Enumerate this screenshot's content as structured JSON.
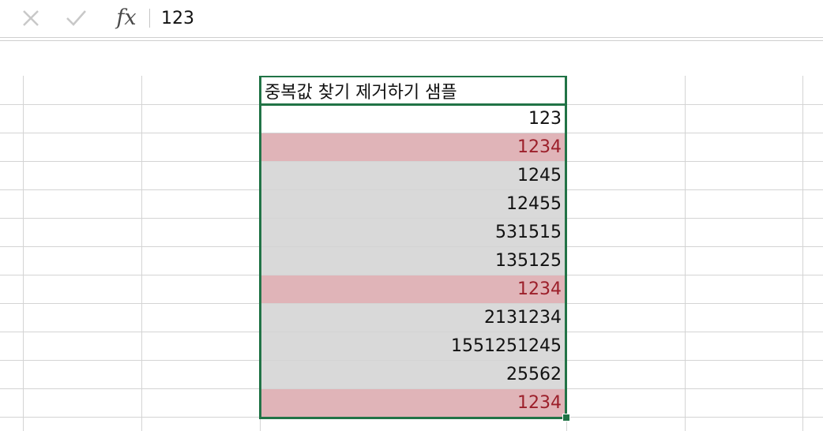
{
  "formula_bar": {
    "cancel_icon": "x-icon",
    "enter_icon": "check-icon",
    "fx_label": "fx",
    "value": "123"
  },
  "sheet": {
    "header": "중복값 찾기 제거하기 샘플",
    "cells": [
      {
        "value": "123",
        "style": "first"
      },
      {
        "value": "1234",
        "style": "dup"
      },
      {
        "value": "1245",
        "style": "normal"
      },
      {
        "value": "12455",
        "style": "normal"
      },
      {
        "value": "531515",
        "style": "normal"
      },
      {
        "value": "135125",
        "style": "normal"
      },
      {
        "value": "1234",
        "style": "dup"
      },
      {
        "value": "2131234",
        "style": "normal"
      },
      {
        "value": "1551251245",
        "style": "normal"
      },
      {
        "value": "25562",
        "style": "normal"
      },
      {
        "value": "1234",
        "style": "dup"
      }
    ]
  },
  "colors": {
    "selection": "#217346",
    "duplicate_fill": "#e0b4b8",
    "duplicate_text": "#9c1f2a",
    "normal_fill": "#d9d9d9"
  }
}
